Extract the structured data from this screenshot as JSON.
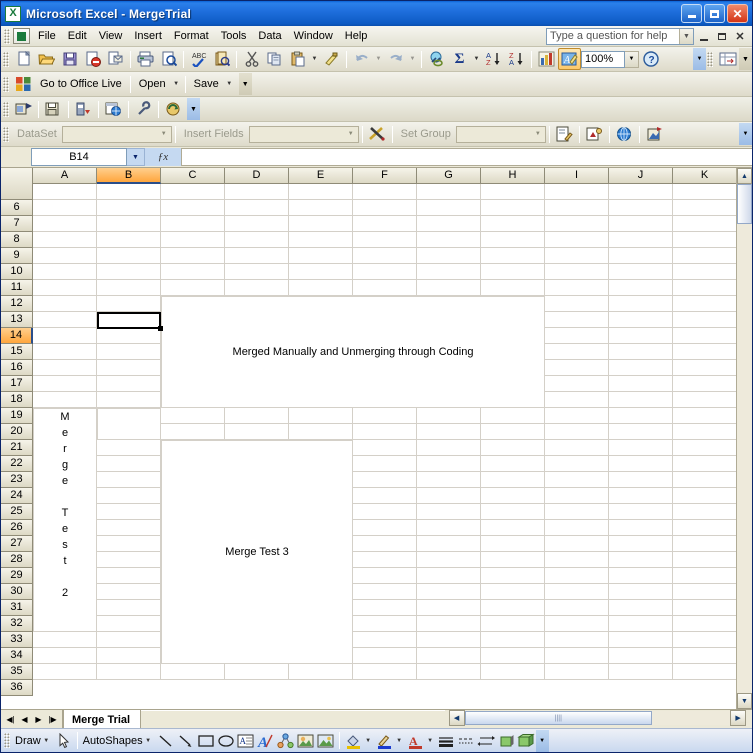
{
  "window": {
    "title": "Microsoft Excel - MergeTrial",
    "app_icon": "excel-icon",
    "minimize": "minimize-icon",
    "maximize": "maximize-icon",
    "close": "close-icon"
  },
  "menu": {
    "items": [
      "File",
      "Edit",
      "View",
      "Insert",
      "Format",
      "Tools",
      "Data",
      "Window",
      "Help"
    ],
    "ask_box_value": "Type a question for help",
    "doc_minimize": "_",
    "doc_restore": "❐",
    "doc_close": "✕"
  },
  "standard_toolbar": {
    "icons": [
      "new-icon",
      "open-icon",
      "save-icon",
      "permission-icon",
      "email-icon",
      "print-icon",
      "print-preview-icon",
      "spelling-icon",
      "research-icon",
      "cut-icon",
      "copy-icon",
      "paste-icon",
      "format-painter-icon",
      "undo-icon",
      "redo-icon",
      "hyperlink-icon",
      "autosum-icon",
      "sort-asc-icon",
      "sort-desc-icon",
      "chart-wizard-icon",
      "drawing-icon",
      "help-icon"
    ],
    "zoom_value": "100%",
    "sort_asc_label": "A↓",
    "sort_desc_label": "Z↓",
    "autosum_label": "Σ"
  },
  "office_live_toolbar": {
    "label": "Go to Office Live",
    "open_label": "Open",
    "save_label": "Save",
    "icon": "office-live-icon"
  },
  "vs_toolbar": {
    "icons": [
      "design-icon",
      "save-all-icon",
      "deploy-icon",
      "browser-icon",
      "properties-icon",
      "refresh-icon"
    ]
  },
  "data_toolbar": {
    "dataset_label": "DataSet",
    "dataset_value": "",
    "insert_fields_label": "Insert Fields",
    "insert_fields_value": "",
    "set_group_label": "Set Group",
    "set_group_value": "",
    "tools_icon": "crossed-tools-icon",
    "right_icons": [
      "edit-report-icon",
      "preview-icon",
      "globe-icon",
      "export-icon"
    ]
  },
  "formula_bar": {
    "name_box_value": "B14",
    "fx_label": "ƒx",
    "formula_value": ""
  },
  "grid": {
    "columns": [
      "A",
      "B",
      "C",
      "D",
      "E",
      "F",
      "G",
      "H",
      "I",
      "J",
      "K"
    ],
    "selected_column": "B",
    "rows": [
      6,
      7,
      8,
      9,
      10,
      11,
      12,
      13,
      14,
      15,
      16,
      17,
      18,
      19,
      20,
      21,
      22,
      23,
      24,
      25,
      26,
      27,
      28,
      29,
      30,
      31,
      32,
      33,
      34,
      35,
      36
    ],
    "selected_row": 14,
    "active_cell": "B14",
    "merged_cells": [
      {
        "name": "merged-banner",
        "text": "Merged Manually and Unmerging through Coding",
        "range": "C13:H19",
        "col_start": 2,
        "col_span": 6,
        "row_start": 13,
        "row_span": 7,
        "orientation": "horizontal"
      },
      {
        "name": "merged-vertical-label",
        "text": "Merge Test 2",
        "chars": [
          "M",
          "e",
          "r",
          "g",
          "e",
          " ",
          "T",
          "e",
          "s",
          "t",
          " ",
          "2"
        ],
        "range": "A20:A33",
        "col_start": 0,
        "col_span": 1,
        "row_start": 20,
        "row_span": 14,
        "orientation": "vertical"
      },
      {
        "name": "merged-test3",
        "text": "Merge Test 3",
        "range": "C22:E35",
        "col_start": 2,
        "col_span": 3,
        "row_start": 22,
        "row_span": 14,
        "orientation": "horizontal"
      },
      {
        "name": "merged-strip-b",
        "text": "",
        "range": "B20:B21",
        "col_start": 1,
        "col_span": 1,
        "row_start": 20,
        "row_span": 2,
        "orientation": "horizontal"
      }
    ]
  },
  "sheet_tabs": {
    "first_label": "⏮",
    "prev_label": "◀",
    "next_label": "▶",
    "last_label": "⏭",
    "tabs": [
      {
        "label": "Merge Trial",
        "active": true
      }
    ]
  },
  "drawing_toolbar": {
    "draw_label": "Draw",
    "autoshapes_label": "AutoShapes",
    "icons": [
      "select-objects-icon",
      "line-icon",
      "arrow-icon",
      "rectangle-icon",
      "oval-icon",
      "text-box-icon",
      "wordart-icon",
      "diagram-icon",
      "clip-art-icon",
      "picture-icon",
      "fill-color-icon",
      "line-color-icon",
      "font-color-icon",
      "line-style-icon",
      "dash-style-icon",
      "arrow-style-icon",
      "shadow-style-icon",
      "3d-style-icon"
    ]
  },
  "colors": {
    "title_blue": "#0d5bc4",
    "selected_header": "#ffa63d",
    "toolbar_bg": "#ece9d8",
    "grid_line": "#d4d0c8"
  }
}
